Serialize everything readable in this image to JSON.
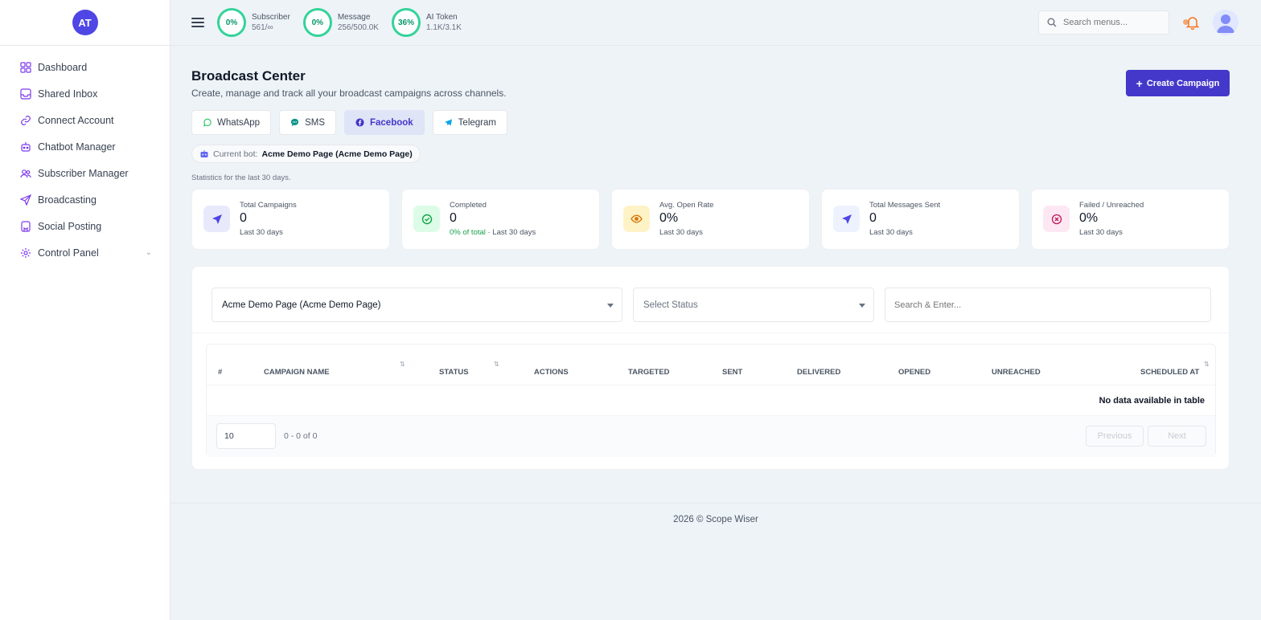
{
  "sidebar": {
    "avatar_initials": "AT",
    "items": [
      {
        "label": "Dashboard",
        "icon": "grid-icon"
      },
      {
        "label": "Shared Inbox",
        "icon": "inbox-icon"
      },
      {
        "label": "Connect Account",
        "icon": "link-icon"
      },
      {
        "label": "Chatbot Manager",
        "icon": "robot-icon"
      },
      {
        "label": "Subscriber Manager",
        "icon": "users-icon"
      },
      {
        "label": "Broadcasting",
        "icon": "send-icon"
      },
      {
        "label": "Social Posting",
        "icon": "bookmark-icon"
      },
      {
        "label": "Control Panel",
        "icon": "gear-icon"
      }
    ]
  },
  "header": {
    "usage": [
      {
        "percent": "0%",
        "label": "Subscriber",
        "value": "561/∞"
      },
      {
        "percent": "0%",
        "label": "Message",
        "value": "256/500.0K"
      },
      {
        "percent": "36%",
        "label": "AI Token",
        "value": "1.1K/3.1K"
      }
    ],
    "search_placeholder": "Search menus..."
  },
  "main": {
    "title": "Broadcast Center",
    "subtitle": "Create, manage and track all your broadcast campaigns across channels.",
    "create_label": "Create Campaign",
    "tabs": [
      {
        "label": "WhatsApp"
      },
      {
        "label": "SMS"
      },
      {
        "label": "Facebook"
      },
      {
        "label": "Telegram"
      }
    ],
    "current_bot_label": "Current bot:",
    "current_bot_value": "Acme Demo Page (Acme Demo Page)",
    "stats_note": "Statistics for the last 30 days.",
    "stats": [
      {
        "label": "Total Campaigns",
        "value": "0",
        "sub": "Last 30 days"
      },
      {
        "label": "Completed",
        "value": "0",
        "sub_green": "0% of total",
        "sub": " · Last 30 days"
      },
      {
        "label": "Avg. Open Rate",
        "value": "0%",
        "sub": "Last 30 days"
      },
      {
        "label": "Total Messages Sent",
        "value": "0",
        "sub": "Last 30 days"
      },
      {
        "label": "Failed / Unreached",
        "value": "0%",
        "sub": "Last 30 days"
      }
    ]
  },
  "table": {
    "page_select": "Acme Demo Page (Acme Demo Page)",
    "status_select": "Select Status",
    "search_placeholder": "Search & Enter...",
    "columns": [
      "#",
      "Campaign Name",
      "Status",
      "Actions",
      "Targeted",
      "Sent",
      "Delivered",
      "Opened",
      "Unreached",
      "Scheduled At"
    ],
    "empty_text": "No data available in table",
    "page_size": "10",
    "page_info": "0 - 0 of 0",
    "prev_label": "Previous",
    "next_label": "Next"
  },
  "footer": {
    "text": "2026 © Scope Wiser"
  },
  "colors": {
    "accent": "#4338ca",
    "ring": "#34d399",
    "success": "#16a34a"
  }
}
